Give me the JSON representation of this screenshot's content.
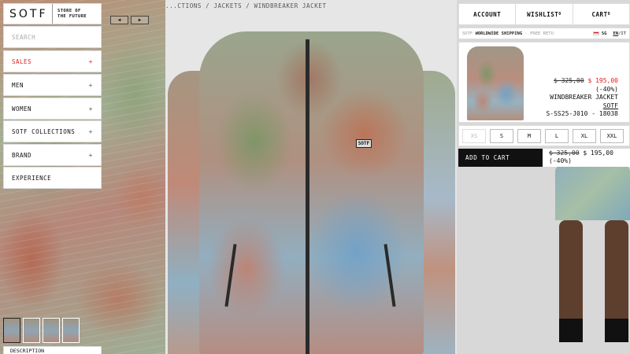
{
  "brand": {
    "logo": "SOTF",
    "tagline_line1": "STORE OF",
    "tagline_line2": "THE FUTURE"
  },
  "search": {
    "placeholder": "SEARCH"
  },
  "nav": {
    "items": [
      {
        "label": "SALES",
        "icon": "+"
      },
      {
        "label": "MEN",
        "icon": "+"
      },
      {
        "label": "WOMEN",
        "icon": "+"
      },
      {
        "label": "SOTF COLLECTIONS",
        "icon": "+"
      },
      {
        "label": "BRAND",
        "icon": "+"
      },
      {
        "label": "EXPERIENCE",
        "icon": ""
      }
    ],
    "bottom_label": "DESCRIPTION"
  },
  "gallery": {
    "prev": "◀",
    "next": "▶",
    "thumbnail_count": 4
  },
  "breadcrumb": "...CTIONS / JACKETS / WINDBREAKER JACKET",
  "product_patch": "SOTF",
  "header": {
    "account": "ACCOUNT",
    "wishlist": "WISHLIST",
    "wishlist_count": "0",
    "cart": "CART",
    "cart_count": "0"
  },
  "shipping": {
    "prefix": "SOTF ",
    "highlight": "WORLDWIDE SHIPPING",
    "suffix": " - FREE RETU",
    "country": "SG",
    "lang_active": "EN",
    "lang_sep": "/",
    "lang_other": "IT"
  },
  "product": {
    "old_price": "$ 325,00",
    "new_price": "$ 195,00",
    "discount": "(-40%)",
    "name": "WINDBREAKER JACKET",
    "brand": "SOTF",
    "sku": "S-SS25-J010 - 18038"
  },
  "sizes": [
    {
      "label": "XS",
      "available": false
    },
    {
      "label": "S",
      "available": true
    },
    {
      "label": "M",
      "available": true
    },
    {
      "label": "L",
      "available": true
    },
    {
      "label": "XL",
      "available": true
    },
    {
      "label": "XXL",
      "available": true
    }
  ],
  "cart": {
    "button_label": "ADD TO CART",
    "old_price": "$ 325,00",
    "new_price": "$ 195,00",
    "discount": "(-40%)"
  },
  "colors": {
    "accent": "#e21f1f",
    "dark": "#111111"
  }
}
